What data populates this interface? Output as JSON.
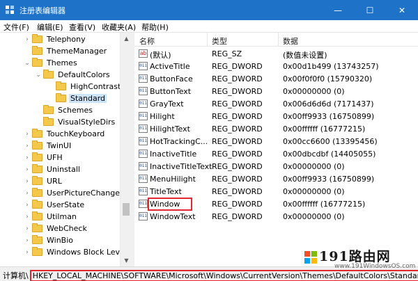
{
  "window": {
    "title": "注册表编辑器",
    "controls": {
      "minimize": "—",
      "maximize": "☐",
      "close": "✕"
    },
    "title_bar_color": "#1e73c9"
  },
  "menu": [
    "文件(F)",
    "编辑(E)",
    "查看(V)",
    "收藏夹(A)",
    "帮助(H)"
  ],
  "tree": [
    {
      "label": "Telephony",
      "expander": "›"
    },
    {
      "label": "ThemeManager",
      "expander": ""
    },
    {
      "label": "Themes",
      "expander": "⌄"
    },
    {
      "label": "DefaultColors",
      "expander": "⌄"
    },
    {
      "label": "HighContrast",
      "expander": ""
    },
    {
      "label": "Standard",
      "expander": "",
      "selected": true
    },
    {
      "label": "Schemes",
      "expander": ""
    },
    {
      "label": "VisualStyleDirs",
      "expander": ""
    },
    {
      "label": "TouchKeyboard",
      "expander": "›"
    },
    {
      "label": "TwinUI",
      "expander": "›"
    },
    {
      "label": "UFH",
      "expander": "›"
    },
    {
      "label": "Uninstall",
      "expander": "›"
    },
    {
      "label": "URL",
      "expander": "›"
    },
    {
      "label": "UserPictureChange",
      "expander": "›"
    },
    {
      "label": "UserState",
      "expander": "›"
    },
    {
      "label": "Utilman",
      "expander": "›"
    },
    {
      "label": "WebCheck",
      "expander": "›"
    },
    {
      "label": "WinBio",
      "expander": "›"
    },
    {
      "label": "Windows Block Level",
      "expander": "›"
    }
  ],
  "columns": {
    "name": "名称",
    "type": "类型",
    "data": "数据"
  },
  "values": [
    {
      "icon": "ab",
      "name": "(默认)",
      "type": "REG_SZ",
      "data": "(数值未设置)"
    },
    {
      "icon": "011",
      "name": "ActiveTitle",
      "type": "REG_DWORD",
      "data": "0x00d1b499 (13743257)"
    },
    {
      "icon": "011",
      "name": "ButtonFace",
      "type": "REG_DWORD",
      "data": "0x00f0f0f0 (15790320)"
    },
    {
      "icon": "011",
      "name": "ButtonText",
      "type": "REG_DWORD",
      "data": "0x00000000 (0)"
    },
    {
      "icon": "011",
      "name": "GrayText",
      "type": "REG_DWORD",
      "data": "0x006d6d6d (7171437)"
    },
    {
      "icon": "011",
      "name": "Hilight",
      "type": "REG_DWORD",
      "data": "0x00ff9933 (16750899)"
    },
    {
      "icon": "011",
      "name": "HilightText",
      "type": "REG_DWORD",
      "data": "0x00ffffff (16777215)"
    },
    {
      "icon": "011",
      "name": "HotTrackingC...",
      "type": "REG_DWORD",
      "data": "0x00cc6600 (13395456)"
    },
    {
      "icon": "011",
      "name": "InactiveTitle",
      "type": "REG_DWORD",
      "data": "0x00dbcdbf (14405055)"
    },
    {
      "icon": "011",
      "name": "InactiveTitleText",
      "type": "REG_DWORD",
      "data": "0x00000000 (0)"
    },
    {
      "icon": "011",
      "name": "MenuHilight",
      "type": "REG_DWORD",
      "data": "0x00ff9933 (16750899)"
    },
    {
      "icon": "011",
      "name": "TitleText",
      "type": "REG_DWORD",
      "data": "0x00000000 (0)"
    },
    {
      "icon": "011",
      "name": "Window",
      "type": "REG_DWORD",
      "data": "0x00ffffff (16777215)",
      "highlighted": true
    },
    {
      "icon": "011",
      "name": "WindowText",
      "type": "REG_DWORD",
      "data": "0x00000000 (0)"
    }
  ],
  "status": {
    "label": "计算机\\",
    "path": "HKEY_LOCAL_MACHINE\\SOFTWARE\\Microsoft\\Windows\\CurrentVersion\\Themes\\DefaultColors\\Standard"
  },
  "watermark": {
    "brand": "191路由网",
    "url": "www.191WindowsOS.com"
  },
  "scrollbar": {
    "up": "▲",
    "down": "▼"
  }
}
